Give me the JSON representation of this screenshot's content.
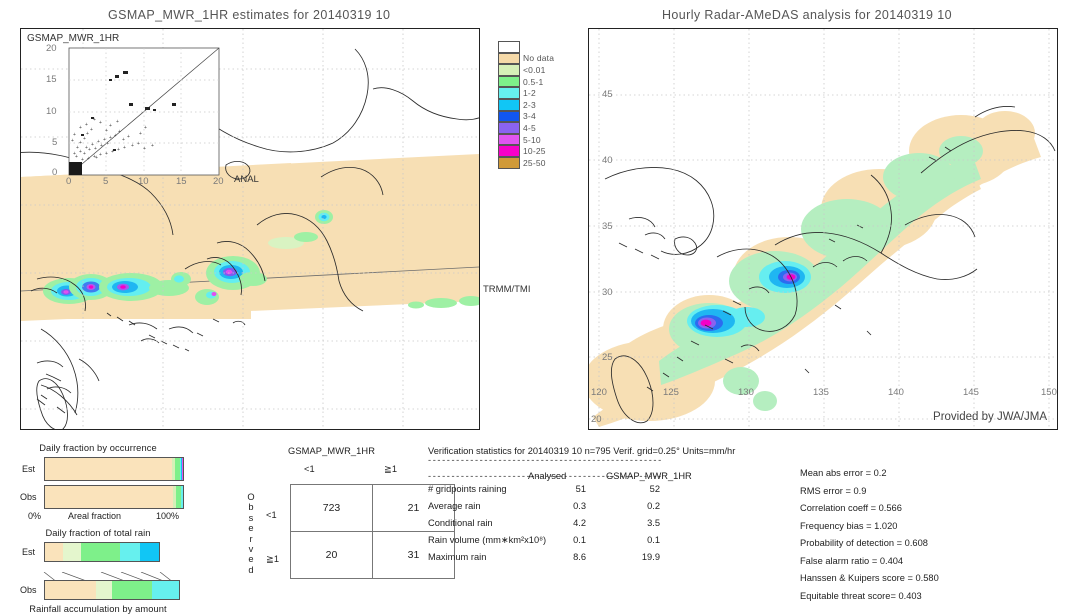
{
  "left_panel": {
    "title": "GSMAP_MWR_1HR estimates for 20140319 10",
    "inset_label": "GSMAP_MWR_1HR",
    "inset_xaxis_label": "ANAL",
    "inset_y_ticks": [
      "20",
      "15",
      "10",
      "5",
      "0"
    ],
    "inset_x_ticks": [
      "0",
      "5",
      "10",
      "15",
      "20"
    ],
    "source_label": "TRMM/TMI"
  },
  "right_panel": {
    "title": "Hourly Radar-AMeDAS analysis for 20140319 10",
    "credit": "Provided by JWA/JMA",
    "x_ticks": [
      "120",
      "125",
      "130",
      "135",
      "140",
      "145",
      "150"
    ],
    "y_ticks": [
      "45",
      "40",
      "35",
      "30",
      "25",
      "20"
    ]
  },
  "colorbar": {
    "items": [
      {
        "label": "",
        "color": "#ffffff"
      },
      {
        "label": "No data",
        "color": "#f5d9a8"
      },
      {
        "label": "<0.01",
        "color": "#d6f0b8"
      },
      {
        "label": "0.5-1",
        "color": "#7ef08a"
      },
      {
        "label": "1-2",
        "color": "#66f0ee"
      },
      {
        "label": "2-3",
        "color": "#11c6f5"
      },
      {
        "label": "3-4",
        "color": "#1156f0"
      },
      {
        "label": "4-5",
        "color": "#8a63f0"
      },
      {
        "label": "5-10",
        "color": "#e055f0"
      },
      {
        "label": "10-25",
        "color": "#f700c8"
      },
      {
        "label": "25-50",
        "color": "#d09a38"
      }
    ]
  },
  "occurrence_chart": {
    "title": "Daily fraction by occurrence",
    "row_est_label": "Est",
    "row_obs_label": "Obs",
    "axis_left": "0%",
    "axis_center": "Areal fraction",
    "axis_right": "100%",
    "est_segments": [
      {
        "color": "#fae3bb",
        "pct": 92.0
      },
      {
        "color": "#d6f0b8",
        "pct": 2.2
      },
      {
        "color": "#7ef08a",
        "pct": 3.4
      },
      {
        "color": "#66f0ee",
        "pct": 0.9
      },
      {
        "color": "#11c6f5",
        "pct": 0.6
      },
      {
        "color": "#1156f0",
        "pct": 0.4
      },
      {
        "color": "#e055f0",
        "pct": 0.5
      }
    ],
    "obs_segments": [
      {
        "color": "#fae3bb",
        "pct": 92.4
      },
      {
        "color": "#d6f0b8",
        "pct": 2.6
      },
      {
        "color": "#7ef08a",
        "pct": 3.6
      },
      {
        "color": "#66f0ee",
        "pct": 1.4
      }
    ]
  },
  "amount_chart": {
    "title": "Daily fraction of total rain",
    "caption": "Rainfall accumulation by amount",
    "row_est_label": "Est",
    "row_obs_label": "Obs",
    "est_segments": [
      {
        "color": "#fae3bb",
        "pct": 16.0
      },
      {
        "color": "#e4f6cd",
        "pct": 16.0
      },
      {
        "color": "#7ef08a",
        "pct": 34.0
      },
      {
        "color": "#66f0ee",
        "pct": 17.0
      },
      {
        "color": "#11c6f5",
        "pct": 17.0
      }
    ],
    "obs_segments": [
      {
        "color": "#fae3bb",
        "pct": 38.0
      },
      {
        "color": "#e4f6cd",
        "pct": 12.0
      },
      {
        "color": "#7ef08a",
        "pct": 30.0
      },
      {
        "color": "#66f0ee",
        "pct": 20.0
      }
    ]
  },
  "contingency": {
    "header": "GSMAP_MWR_1HR",
    "col_headers": [
      "<1",
      "≧1"
    ],
    "row_headers": [
      "<1",
      "≧1"
    ],
    "observed_label": "Observed",
    "values": [
      [
        "723",
        "21"
      ],
      [
        "20",
        "31"
      ]
    ]
  },
  "verification": {
    "header": "Verification statistics for 20140319 10  n=795  Verif. grid=0.25°  Units=mm/hr",
    "rule": "--------------------------------------------------",
    "col_headers": [
      "Analysed",
      "GSMAP_MWR_1HR"
    ],
    "rows": [
      {
        "label": "# gridpoints raining",
        "analysed": "51",
        "estimate": "52"
      },
      {
        "label": "Average rain",
        "analysed": "0.3",
        "estimate": "0.2"
      },
      {
        "label": "Conditional rain",
        "analysed": "4.2",
        "estimate": "3.5"
      },
      {
        "label": "Rain volume (mm∗km²x10⁸)",
        "analysed": "0.1",
        "estimate": "0.1"
      },
      {
        "label": "Maximum rain",
        "analysed": "8.6",
        "estimate": "19.9"
      }
    ],
    "scores": [
      "Mean abs error = 0.2",
      "RMS error = 0.9",
      "Correlation coeff = 0.566",
      "Frequency bias = 1.020",
      "Probability of detection = 0.608",
      "False alarm ratio = 0.404",
      "Hanssen & Kuipers score = 0.580",
      "Equitable threat score= 0.403"
    ]
  }
}
